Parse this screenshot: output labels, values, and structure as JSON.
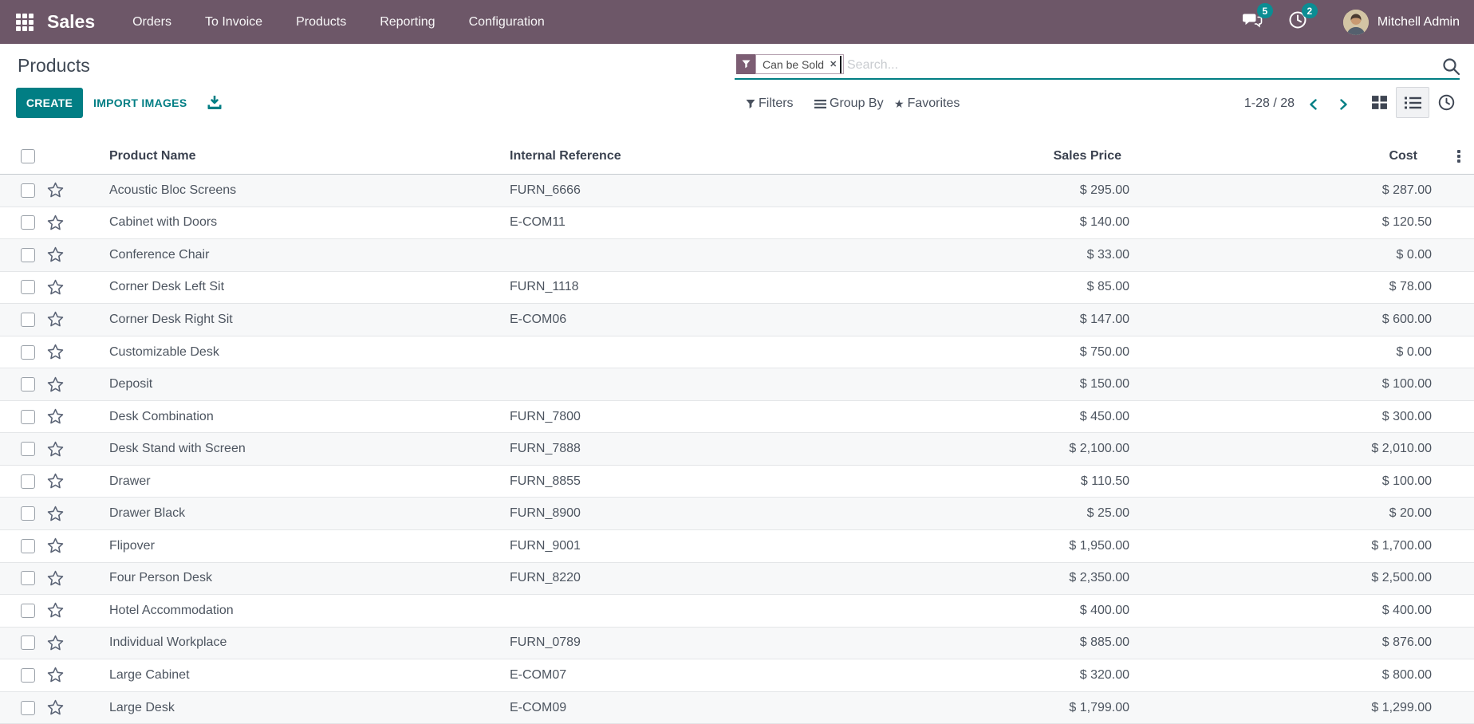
{
  "navbar": {
    "app_name": "Sales",
    "menus": [
      "Orders",
      "To Invoice",
      "Products",
      "Reporting",
      "Configuration"
    ],
    "messages_badge": "5",
    "activities_badge": "2",
    "user_name": "Mitchell Admin"
  },
  "control_panel": {
    "title": "Products",
    "create_label": "CREATE",
    "import_label": "IMPORT IMAGES",
    "search": {
      "facet_label": "Can be Sold",
      "facet_remove": "✕",
      "placeholder": "Search..."
    },
    "filters_label": "Filters",
    "group_by_label": "Group By",
    "favorites_label": "Favorites",
    "pager": "1-28 / 28"
  },
  "table": {
    "columns": {
      "name": "Product Name",
      "ref": "Internal Reference",
      "price": "Sales Price",
      "cost": "Cost"
    },
    "rows": [
      {
        "name": "Acoustic Bloc Screens",
        "ref": "FURN_6666",
        "price": "$ 295.00",
        "cost": "$ 287.00"
      },
      {
        "name": "Cabinet with Doors",
        "ref": "E-COM11",
        "price": "$ 140.00",
        "cost": "$ 120.50"
      },
      {
        "name": "Conference Chair",
        "ref": "",
        "price": "$ 33.00",
        "cost": "$ 0.00"
      },
      {
        "name": "Corner Desk Left Sit",
        "ref": "FURN_1118",
        "price": "$ 85.00",
        "cost": "$ 78.00"
      },
      {
        "name": "Corner Desk Right Sit",
        "ref": "E-COM06",
        "price": "$ 147.00",
        "cost": "$ 600.00"
      },
      {
        "name": "Customizable Desk",
        "ref": "",
        "price": "$ 750.00",
        "cost": "$ 0.00"
      },
      {
        "name": "Deposit",
        "ref": "",
        "price": "$ 150.00",
        "cost": "$ 100.00"
      },
      {
        "name": "Desk Combination",
        "ref": "FURN_7800",
        "price": "$ 450.00",
        "cost": "$ 300.00"
      },
      {
        "name": "Desk Stand with Screen",
        "ref": "FURN_7888",
        "price": "$ 2,100.00",
        "cost": "$ 2,010.00"
      },
      {
        "name": "Drawer",
        "ref": "FURN_8855",
        "price": "$ 110.50",
        "cost": "$ 100.00"
      },
      {
        "name": "Drawer Black",
        "ref": "FURN_8900",
        "price": "$ 25.00",
        "cost": "$ 20.00"
      },
      {
        "name": "Flipover",
        "ref": "FURN_9001",
        "price": "$ 1,950.00",
        "cost": "$ 1,700.00"
      },
      {
        "name": "Four Person Desk",
        "ref": "FURN_8220",
        "price": "$ 2,350.00",
        "cost": "$ 2,500.00"
      },
      {
        "name": "Hotel Accommodation",
        "ref": "",
        "price": "$ 400.00",
        "cost": "$ 400.00"
      },
      {
        "name": "Individual Workplace",
        "ref": "FURN_0789",
        "price": "$ 885.00",
        "cost": "$ 876.00"
      },
      {
        "name": "Large Cabinet",
        "ref": "E-COM07",
        "price": "$ 320.00",
        "cost": "$ 800.00"
      },
      {
        "name": "Large Desk",
        "ref": "E-COM09",
        "price": "$ 1,799.00",
        "cost": "$ 1,299.00"
      }
    ]
  },
  "colors": {
    "accent": "#017e84",
    "navbar_bg": "#6d5768",
    "badge": "#0b8d93",
    "stripe": "#f7f8f9"
  }
}
